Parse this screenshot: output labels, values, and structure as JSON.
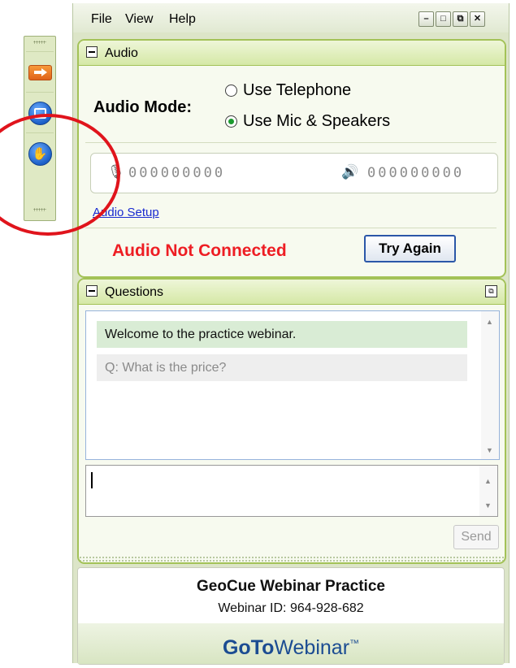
{
  "menu": {
    "file": "File",
    "view": "View",
    "help": "Help"
  },
  "window_controls": {
    "minimize": "–",
    "maximize": "□",
    "restore": "⧉",
    "close": "✕"
  },
  "audio": {
    "title": "Audio",
    "mode_label": "Audio Mode:",
    "option_telephone": "Use Telephone",
    "option_mic": "Use Mic & Speakers",
    "selected": "Use Mic & Speakers",
    "mic_level": "000000000",
    "speaker_level": "000000000",
    "setup_link": "Audio Setup",
    "status": "Audio Not Connected",
    "retry": "Try Again"
  },
  "questions": {
    "title": "Questions",
    "items": [
      {
        "text": "Welcome to the practice webinar."
      },
      {
        "text": "Q: What is the price?"
      }
    ],
    "send": "Send"
  },
  "footer": {
    "webinar_title": "GeoCue Webinar Practice",
    "webinar_id": "Webinar ID: 964-928-682",
    "brand_bold": "GoTo",
    "brand_regular": "Webinar",
    "brand_tm": "™"
  },
  "colors": {
    "accent_green": "#a3c257",
    "status_red": "#ee1d23",
    "link_blue": "#1a2bd0",
    "brand_blue": "#1b4c92",
    "highlight_red": "#e0141c"
  },
  "icons": {
    "side_toolbar": [
      "collapse-arrow-icon",
      "screen-view-icon",
      "raise-hand-icon"
    ],
    "microphone": "microphone-icon",
    "speaker": "speaker-icon"
  }
}
